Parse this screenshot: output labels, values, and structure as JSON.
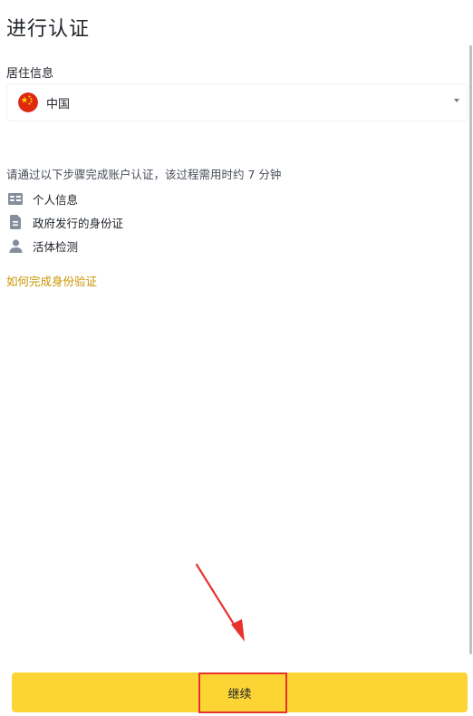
{
  "header": {
    "title": "进行认证"
  },
  "residence": {
    "label": "居住信息",
    "selected_country": "中国",
    "flag_icon": "china-flag-icon"
  },
  "instructions": {
    "intro": "请通过以下步骤完成账户认证，该过程需用时约 7 分钟",
    "steps": [
      {
        "label": "个人信息",
        "icon": "id-card-icon"
      },
      {
        "label": "政府发行的身份证",
        "icon": "document-icon"
      },
      {
        "label": "活体检测",
        "icon": "person-icon"
      }
    ]
  },
  "help": {
    "link_text": "如何完成身份验证"
  },
  "footer": {
    "continue_label": "继续"
  },
  "colors": {
    "accent_yellow": "#fcd535",
    "link_gold": "#c99400",
    "annotation_red": "#e8322e",
    "text_dark": "#1e2329",
    "icon_gray": "#848e9c"
  }
}
